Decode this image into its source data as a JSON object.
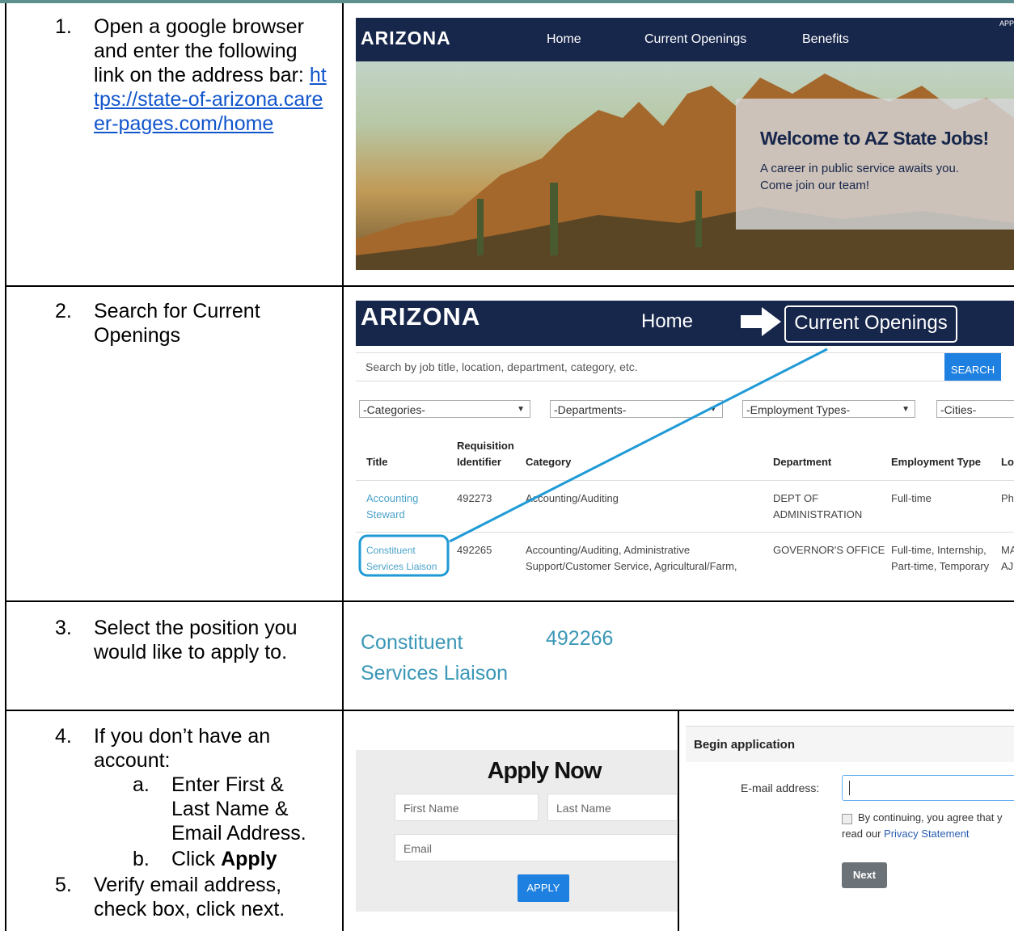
{
  "steps": {
    "s1_num": "1.",
    "s1_text": "Open a google browser and enter the following link on the address bar:",
    "s1_link": "https://state-of-arizona.career-pages.com/home",
    "s2_num": "2.",
    "s2_text": "Search for Current Openings",
    "s3_num": "3.",
    "s3_text": "Select the position you would like to apply to.",
    "s4_num": "4.",
    "s4_text": "If you don’t have an account:",
    "s4a_num": "a.",
    "s4a_text": "Enter First & Last Name & Email Address.",
    "s4b_num": "b.",
    "s4b_prefix": "Click ",
    "s4b_bold": "Apply",
    "s5_num": "5.",
    "s5_text": "Verify email address, check box, click next."
  },
  "shot1": {
    "logo": "ARIZONA",
    "nav_home": "Home",
    "nav_openings": "Current Openings",
    "nav_benefits": "Benefits",
    "corner": "APP",
    "welcome_title": "Welcome to AZ State Jobs!",
    "welcome_text": "A career in public service awaits you. Come join our team!"
  },
  "shot2": {
    "logo": "ARIZONA",
    "nav_home": "Home",
    "nav_openings": "Current Openings",
    "search_placeholder": "Search by job title, location, department, category, etc.",
    "search_button": "SEARCH",
    "dd_categories": "-Categories-",
    "dd_departments": "-Departments-",
    "dd_employment": "-Employment Types-",
    "dd_cities": "-Cities-",
    "headers": {
      "title": "Title",
      "requisition": "Requisition Identifier",
      "category": "Category",
      "department": "Department",
      "employment": "Employment Type",
      "location": "Lo"
    },
    "rows": [
      {
        "title": "Accounting Steward",
        "id": "492273",
        "category": "Accounting/Auditing",
        "department": "DEPT OF ADMINISTRATION",
        "employment": "Full-time",
        "location": "Ph"
      },
      {
        "title": "Constituent Services Liaison",
        "id": "492265",
        "category": "Accounting/Auditing, Administrative Support/Customer Service, Agricultural/Farm,",
        "department": "GOVERNOR'S OFFICE",
        "employment": "Full-time, Internship, Part-time, Temporary",
        "location": "MA AJ"
      }
    ]
  },
  "shot3": {
    "title": "Constituent Services Liaison",
    "id": "492266"
  },
  "shot4": {
    "heading": "Apply Now",
    "first_placeholder": "First Name",
    "last_placeholder": "Last Name",
    "email_placeholder": "Email",
    "apply_button": "APPLY",
    "begin_title": "Begin application",
    "email_label": "E-mail address:",
    "agree_text": "By continuing, you agree that y",
    "agree_text2": "read our ",
    "privacy_link": "Privacy Statement",
    "next_button": "Next"
  },
  "colors": {
    "navy": "#17264b",
    "button_blue": "#1e80e0",
    "link_teal": "#3a97b6",
    "callout_blue": "#1f9ad6"
  }
}
